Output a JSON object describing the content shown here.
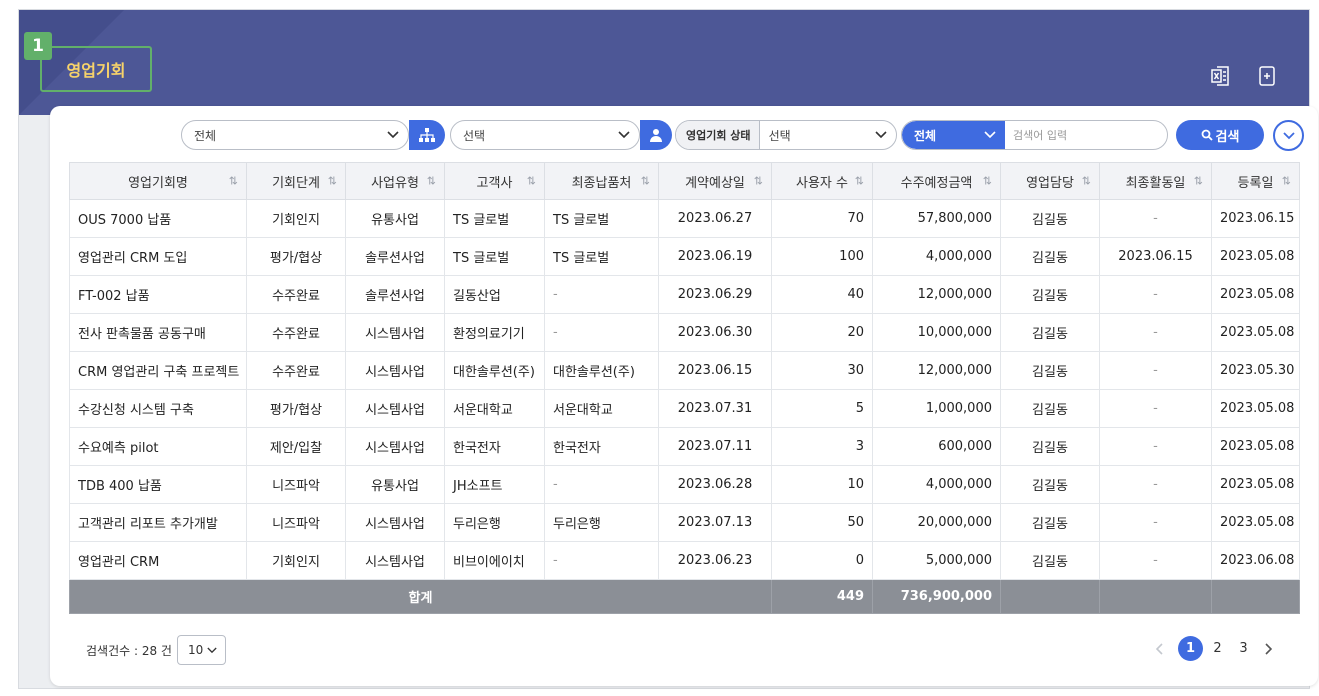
{
  "step_badge": "1",
  "page_title": "영업기회",
  "header_icons": [
    "excel-export-icon",
    "add-document-icon"
  ],
  "filters": {
    "org_select": "전체",
    "person_select": "선택",
    "status_label": "영업기회 상태",
    "status_select": "선택",
    "search_scope": "전체",
    "search_placeholder": "검색어 입력",
    "search_button": "검색"
  },
  "table": {
    "columns": [
      "영업기회명",
      "기회단계",
      "사업유형",
      "고객사",
      "최종납품처",
      "계약예상일",
      "사용자 수",
      "수주예정금액",
      "영업담당",
      "최종활동일",
      "등록일"
    ],
    "rows": [
      [
        "OUS 7000 납품",
        "기회인지",
        "유통사업",
        "TS 글로벌",
        "TS 글로벌",
        "2023.06.27",
        "70",
        "57,800,000",
        "김길동",
        "-",
        "2023.06.15"
      ],
      [
        "영업관리 CRM 도입",
        "평가/협상",
        "솔루션사업",
        "TS 글로벌",
        "TS 글로벌",
        "2023.06.19",
        "100",
        "4,000,000",
        "김길동",
        "2023.06.15",
        "2023.05.08"
      ],
      [
        "FT-002 납품",
        "수주완료",
        "솔루션사업",
        "길동산업",
        "-",
        "2023.06.29",
        "40",
        "12,000,000",
        "김길동",
        "-",
        "2023.05.08"
      ],
      [
        "전사 판촉물품 공동구매",
        "수주완료",
        "시스템사업",
        "환정의료기기",
        "-",
        "2023.06.30",
        "20",
        "10,000,000",
        "김길동",
        "-",
        "2023.05.08"
      ],
      [
        "CRM 영업관리 구축 프로젝트",
        "수주완료",
        "시스템사업",
        "대한솔루션(주)",
        "대한솔루션(주)",
        "2023.06.15",
        "30",
        "12,000,000",
        "김길동",
        "-",
        "2023.05.30"
      ],
      [
        "수강신청 시스템 구축",
        "평가/협상",
        "시스템사업",
        "서운대학교",
        "서운대학교",
        "2023.07.31",
        "5",
        "1,000,000",
        "김길동",
        "-",
        "2023.05.08"
      ],
      [
        "수요예측 pilot",
        "제안/입찰",
        "시스템사업",
        "한국전자",
        "한국전자",
        "2023.07.11",
        "3",
        "600,000",
        "김길동",
        "-",
        "2023.05.08"
      ],
      [
        "TDB 400 납품",
        "니즈파악",
        "유통사업",
        "JH소프트",
        "-",
        "2023.06.28",
        "10",
        "4,000,000",
        "김길동",
        "-",
        "2023.05.08"
      ],
      [
        "고객관리 리포트 추가개발",
        "니즈파악",
        "시스템사업",
        "두리은행",
        "두리은행",
        "2023.07.13",
        "50",
        "20,000,000",
        "김길동",
        "-",
        "2023.05.08"
      ],
      [
        "영업관리 CRM",
        "기회인지",
        "시스템사업",
        "비브이에이치",
        "-",
        "2023.06.23",
        "0",
        "5,000,000",
        "김길동",
        "-",
        "2023.06.08"
      ]
    ],
    "total": {
      "label": "합계",
      "users": "449",
      "amount": "736,900,000"
    }
  },
  "footer": {
    "count_text": "검색건수 : 28 건",
    "page_size": "10",
    "pages": [
      "1",
      "2",
      "3"
    ],
    "current_page": "1"
  },
  "colors": {
    "banner": "#4d5796",
    "accent": "#3f6be0",
    "badge": "#62b06a",
    "title_text": "#f7d36a",
    "total_row": "#8b8f96"
  }
}
